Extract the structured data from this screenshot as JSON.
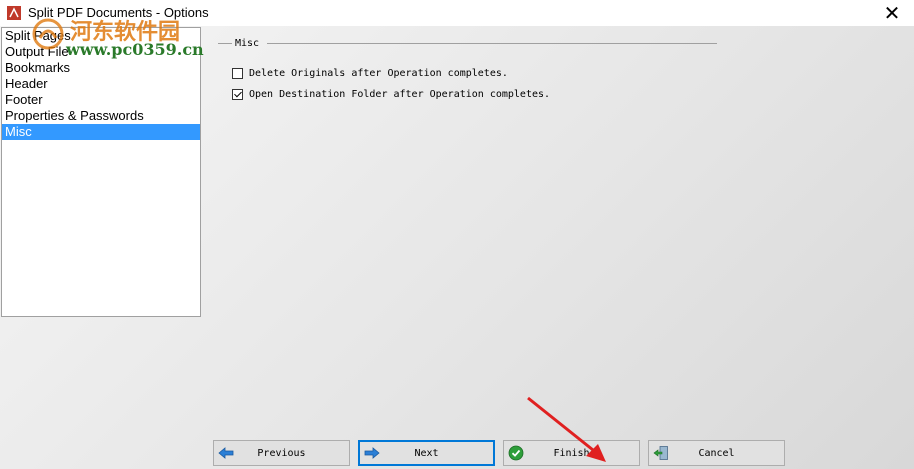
{
  "window": {
    "title": "Split PDF Documents - Options",
    "close_glyph": "✕"
  },
  "nav": {
    "items": [
      {
        "label": "Split Pages",
        "selected": false
      },
      {
        "label": "Output File",
        "selected": false
      },
      {
        "label": "Bookmarks",
        "selected": false
      },
      {
        "label": "Header",
        "selected": false
      },
      {
        "label": "Footer",
        "selected": false
      },
      {
        "label": "Properties & Passwords",
        "selected": false
      },
      {
        "label": "Misc",
        "selected": true
      }
    ]
  },
  "misc": {
    "group_label": "Misc",
    "options": [
      {
        "label": "Delete Originals after Operation completes.",
        "checked": false
      },
      {
        "label": "Open Destination Folder after Operation completes.",
        "checked": true
      }
    ]
  },
  "buttons": {
    "previous": {
      "label": "Previous",
      "icon": "arrow-left-icon"
    },
    "next": {
      "label": "Next",
      "icon": "arrow-right-icon"
    },
    "finish": {
      "label": "Finish",
      "icon": "check-circle-icon"
    },
    "cancel": {
      "label": "Cancel",
      "icon": "exit-door-icon"
    }
  },
  "watermark": {
    "text": "河东软件园",
    "url": "www.pc0359.cn"
  },
  "colors": {
    "selection": "#3399ff",
    "accent_button_border": "#0078d7",
    "annotation_arrow": "#e02020"
  }
}
